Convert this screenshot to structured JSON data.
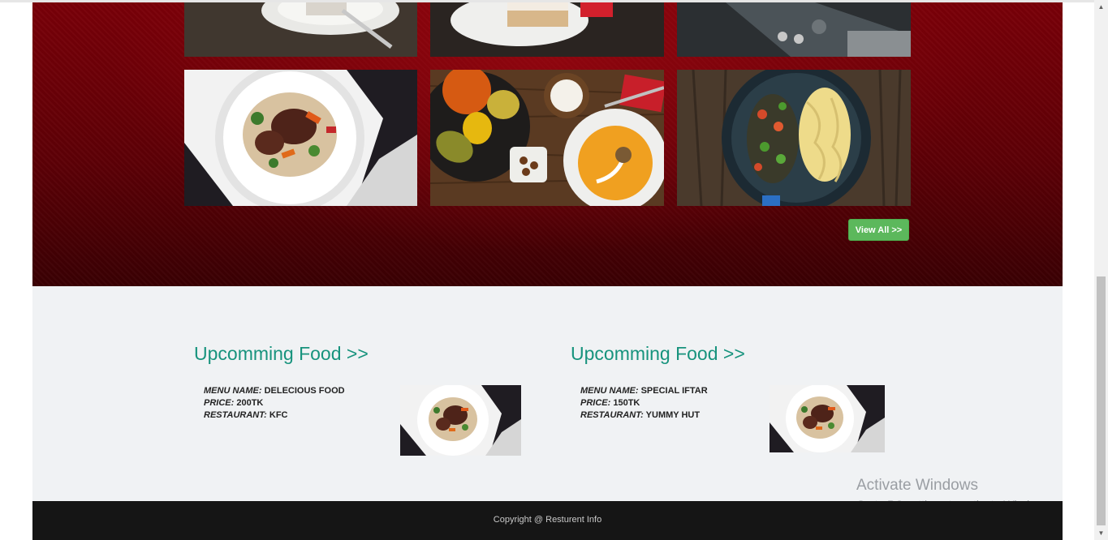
{
  "gallery": {
    "view_all_label": "View All >>"
  },
  "upcoming": {
    "cards": [
      {
        "title": "Upcomming Food >>",
        "menu_label": "MENU NAME:",
        "menu_value": "DELECIOUS FOOD",
        "price_label": "PRICE:",
        "price_value": "200TK",
        "restaurant_label": "RESTAURANT:",
        "restaurant_value": "KFC"
      },
      {
        "title": "Upcomming Food >>",
        "menu_label": "MENU NAME:",
        "menu_value": "SPECIAL IFTAR",
        "price_label": "PRICE:",
        "price_value": "150TK",
        "restaurant_label": "RESTAURANT:",
        "restaurant_value": "YUMMY HUT"
      }
    ]
  },
  "watermark": {
    "line1": "Activate Windows",
    "line2": "Go to PC settings to activate Windows."
  },
  "footer": {
    "copyright": "Copyright @ Resturent Info"
  },
  "colors": {
    "accent_teal": "#17937d",
    "button_green": "#5cb85c",
    "gallery_red": "#6e0007",
    "footer_dark": "#151515"
  }
}
